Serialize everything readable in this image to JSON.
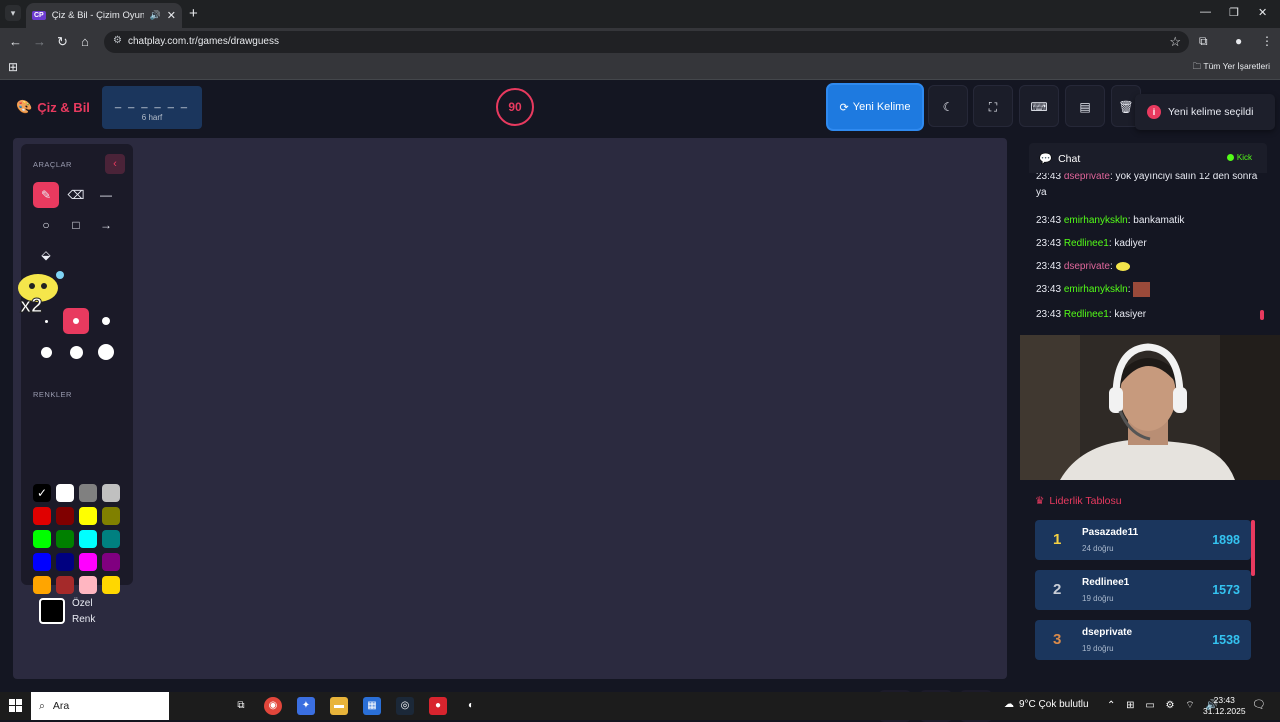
{
  "browser": {
    "tab_title": "Çiz & Bil - Çizim Oyunu",
    "tab_favicon": "CP",
    "url": "chatplay.com.tr/games/drawguess",
    "bookmarks_all": "Tüm Yer İşaretleri"
  },
  "header": {
    "logo": "Çiz & Bil",
    "word_mask": "_ _ _ _ _ _",
    "word_length": "6 harf",
    "timer": "90",
    "new_word_label": "Yeni Kelime",
    "toast": "Yeni kelime seçildi",
    "accent_color": "#e83a5f",
    "primary_color": "#1e7ae0"
  },
  "tools": {
    "title": "ARAÇLAR",
    "colors_title": "RENKLER",
    "custom_color_label": "Özel Renk",
    "active_tool": "brush",
    "colors": [
      "#000000",
      "#ffffff",
      "#808080",
      "#c0c0c0",
      "#e00000",
      "#800000",
      "#ffff00",
      "#808000",
      "#00ff00",
      "#008000",
      "#00ffff",
      "#008080",
      "#0000ff",
      "#000080",
      "#ff00ff",
      "#800080",
      "#ffa500",
      "#a52a2a",
      "#ffb6c1",
      "#ffd700"
    ]
  },
  "sticker": {
    "label": "x2"
  },
  "chat": {
    "title": "Chat",
    "platform": "Kick",
    "messages": [
      {
        "time": "23:43",
        "user": "dseprivate",
        "text": ": yok yayınciyi salın 12 den sonra ya",
        "color": "pink"
      },
      {
        "time": "23:43",
        "user": "emirhanykskln",
        "text": ": bankamatik",
        "color": "green"
      },
      {
        "time": "23:43",
        "user": "Redlinee1",
        "text": ": kadiyer",
        "color": "green"
      },
      {
        "time": "23:43",
        "user": "dseprivate",
        "text": ":",
        "color": "pink"
      },
      {
        "time": "23:43",
        "user": "emirhanykskln",
        "text": ":",
        "color": "green"
      },
      {
        "time": "23:43",
        "user": "Redlinee1",
        "text": ": kasiyer",
        "color": "green"
      }
    ]
  },
  "leaderboard": {
    "title": "Liderlik Tablosu",
    "rows": [
      {
        "rank": "1",
        "name": "Pasazade11",
        "sub": "24 doğru",
        "score": "1898",
        "rank_color": "#f5d142"
      },
      {
        "rank": "2",
        "name": "Redlinee1",
        "sub": "19 doğru",
        "score": "1573",
        "rank_color": "#c8cdd6"
      },
      {
        "rank": "3",
        "name": "dseprivate",
        "sub": "19 doğru",
        "score": "1538",
        "rank_color": "#d98a4a"
      }
    ]
  },
  "taskbar": {
    "search": "Ara",
    "weather": "9°C  Çok bulutlu",
    "time": "23:43",
    "date": "31.12.2025"
  }
}
